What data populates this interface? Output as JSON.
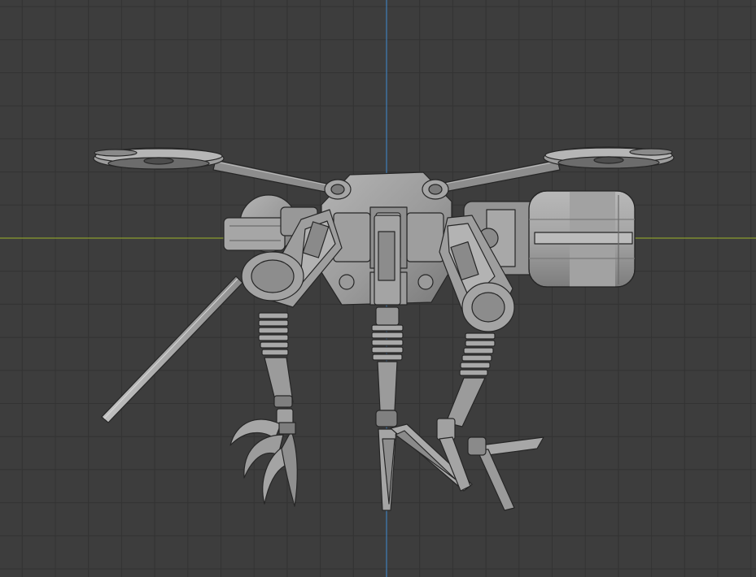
{
  "viewport": {
    "view": "front-orthographic",
    "shading": "solid",
    "grid": true,
    "colors": {
      "background": "#3d3d3d",
      "grid_line": "#333333",
      "x_axis": "#8a9b2f",
      "z_axis": "#3f79b0",
      "model_light": "#a9a9a9",
      "model_mid": "#8b8b8b",
      "model_dark": "#5f5f5f",
      "model_outline": "#262626"
    }
  },
  "scene": {
    "object": "robot-insect-drone",
    "parts": [
      "propeller-left",
      "propeller-right",
      "body-core",
      "right-tank",
      "left-shoulder",
      "left-rod",
      "left-front-leg",
      "center-leg",
      "right-front-leg",
      "left-claw",
      "center-blade-foot",
      "right-blade-foot"
    ]
  }
}
